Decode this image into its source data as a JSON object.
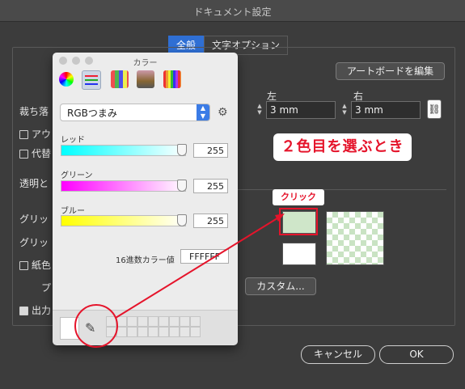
{
  "window": {
    "title": "ドキュメント設定"
  },
  "tabs": [
    {
      "label": "全般",
      "active": true
    },
    {
      "label": "文字オプション",
      "active": false
    }
  ],
  "dialog": {
    "artboard_button": "アートボードを編集",
    "bleed_label": "裁ち落",
    "left_label": "左",
    "right_label": "右",
    "left_value": "3 mm",
    "right_value": "3 mm",
    "outline_label": "アウ",
    "substitute_label": "代替",
    "transparency_label": "透明と",
    "grid1_label": "グリッ",
    "grid2_label": "グリッ",
    "paper_label": "紙色",
    "preset_label": "プ",
    "output_label": "出力",
    "custom_button": "カスタム...",
    "cancel_button": "キャンセル",
    "ok_button": "OK",
    "grid_color_swatch": "#cfe6c9",
    "grid_color_swatch2": "#ffffff"
  },
  "color_panel": {
    "title": "カラー",
    "mode": "RGBつまみ",
    "sliders": [
      {
        "label": "レッド",
        "value": "255",
        "gradient_from": "#00ffff",
        "gradient_to": "#ffffff"
      },
      {
        "label": "グリーン",
        "value": "255",
        "gradient_from": "#ff00ff",
        "gradient_to": "#ffffff"
      },
      {
        "label": "ブルー",
        "value": "255",
        "gradient_from": "#ffff00",
        "gradient_to": "#ffffff"
      }
    ],
    "hex_label": "16進数カラー値",
    "hex_value": "FFFFFF"
  },
  "annotation": {
    "callout": "２色目を選ぶとき",
    "click_label": "クリック",
    "accent_color": "#e5142b"
  }
}
